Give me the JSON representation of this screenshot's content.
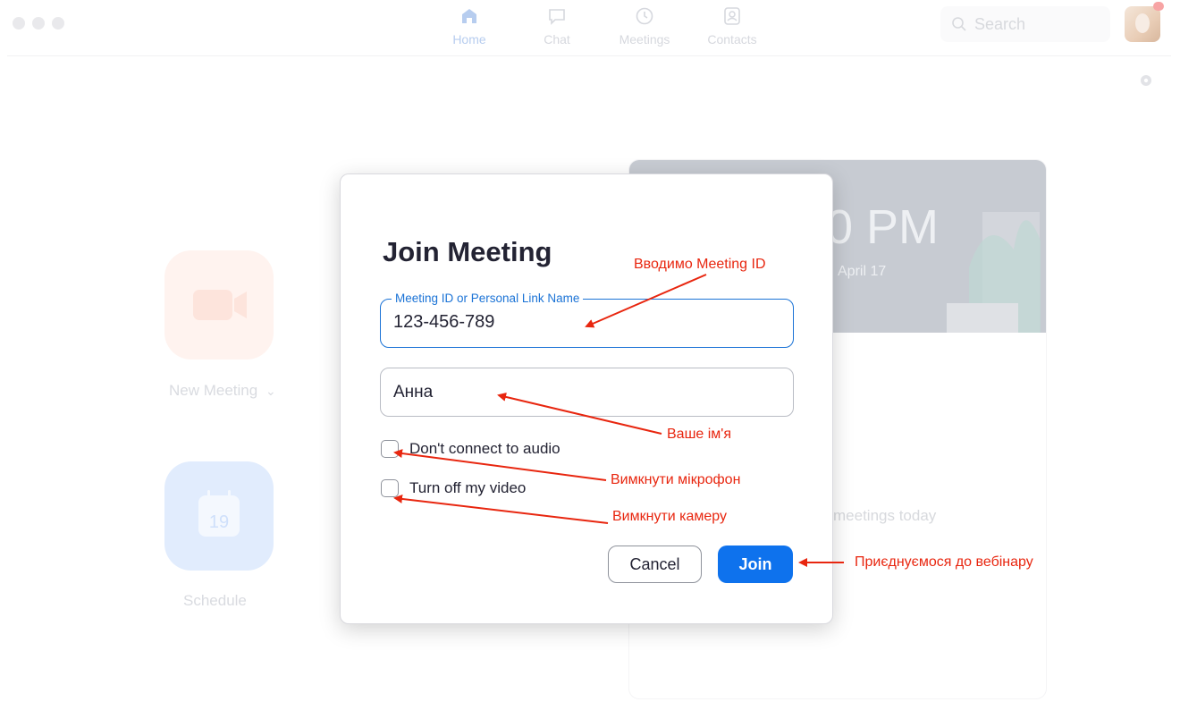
{
  "topnav": {
    "items": [
      {
        "label": "Home",
        "icon": "home-icon",
        "active": true
      },
      {
        "label": "Chat",
        "icon": "chat-icon",
        "active": false
      },
      {
        "label": "Meetings",
        "icon": "clock-icon",
        "active": false
      },
      {
        "label": "Contacts",
        "icon": "contacts-icon",
        "active": false
      }
    ],
    "search_placeholder": "Search"
  },
  "home": {
    "new_meeting_label": "New Meeting",
    "new_meeting_chevron": "⌄",
    "schedule_label": "Schedule",
    "schedule_day": "19",
    "banner_time": "0 PM",
    "banner_date": "April 17",
    "empty_text": "meetings today"
  },
  "dialog": {
    "title": "Join Meeting",
    "meeting_id_label": "Meeting ID or Personal Link Name",
    "meeting_id_value": "123-456-789",
    "name_value": "Анна",
    "checkbox_audio": "Don't connect to audio",
    "checkbox_video": "Turn off my video",
    "cancel_label": "Cancel",
    "join_label": "Join"
  },
  "annotations": {
    "meeting_id": "Вводимо Meeting ID",
    "your_name": "Ваше ім'я",
    "mic_off": "Вимкнути мікрофон",
    "camera_off": "Вимкнути камеру",
    "join_webinar": "Приєднуємося до вебінару"
  },
  "colors": {
    "accent": "#0e72ed",
    "annotation": "#e8260f",
    "text": "#232333"
  }
}
